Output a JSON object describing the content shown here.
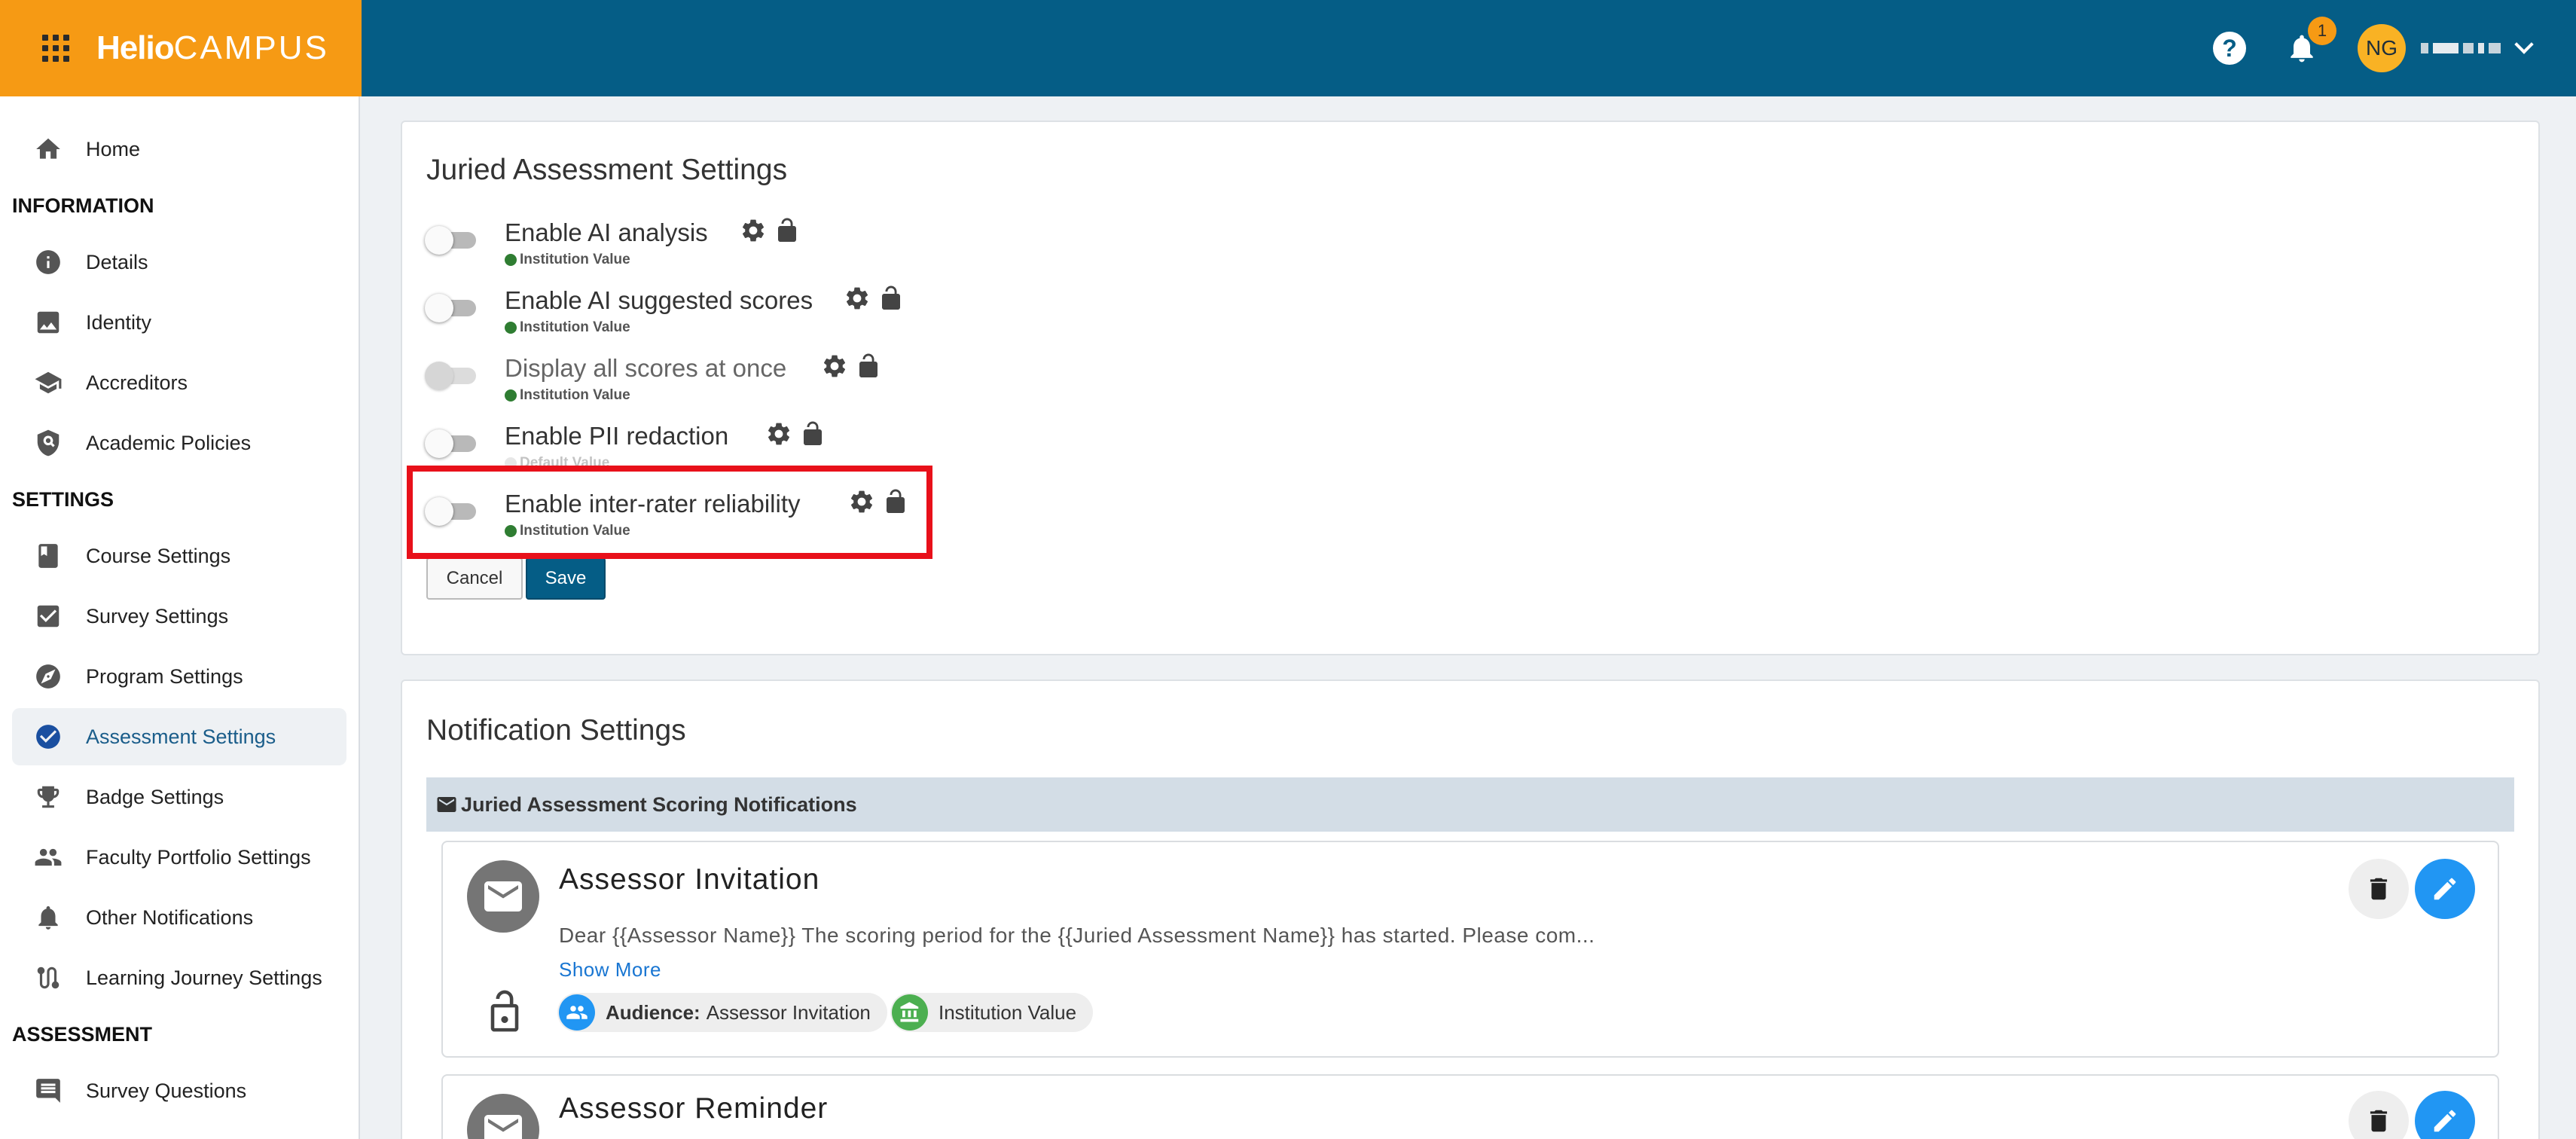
{
  "brand": {
    "logo_bold": "Helio",
    "logo_thin": "CAMPUS"
  },
  "header": {
    "help_glyph": "?",
    "notification_count": "1",
    "user_initials": "NG"
  },
  "sidebar": {
    "items": [
      {
        "label": "Home",
        "icon": "home-icon"
      },
      {
        "label": "Details",
        "icon": "info-icon"
      },
      {
        "label": "Identity",
        "icon": "image-icon"
      },
      {
        "label": "Accreditors",
        "icon": "school-icon"
      },
      {
        "label": "Academic Policies",
        "icon": "policy-icon"
      },
      {
        "label": "Course Settings",
        "icon": "book-icon"
      },
      {
        "label": "Survey Settings",
        "icon": "checkbox-icon"
      },
      {
        "label": "Program Settings",
        "icon": "compass-icon"
      },
      {
        "label": "Assessment Settings",
        "icon": "check-circle-icon"
      },
      {
        "label": "Badge Settings",
        "icon": "trophy-icon"
      },
      {
        "label": "Faculty Portfolio Settings",
        "icon": "people-icon"
      },
      {
        "label": "Other Notifications",
        "icon": "bell-icon"
      },
      {
        "label": "Learning Journey Settings",
        "icon": "route-icon"
      },
      {
        "label": "Survey Questions",
        "icon": "comment-icon"
      }
    ],
    "sections": [
      "INFORMATION",
      "SETTINGS",
      "ASSESSMENT"
    ]
  },
  "juried": {
    "title": "Juried Assessment Settings",
    "settings": [
      {
        "label": "Enable AI analysis",
        "sub": "Institution Value",
        "enabled": false
      },
      {
        "label": "Enable AI suggested scores",
        "sub": "Institution Value",
        "enabled": false
      },
      {
        "label": "Display all scores at once",
        "sub": "Institution Value",
        "enabled": false,
        "disabled": true
      },
      {
        "label": "Enable PII redaction",
        "sub": "Default Value",
        "enabled": false
      },
      {
        "label": "Enable inter-rater reliability",
        "sub": "Institution Value",
        "enabled": false
      }
    ],
    "cancel_label": "Cancel",
    "save_label": "Save"
  },
  "notifications": {
    "title": "Notification Settings",
    "group_label": "Juried Assessment Scoring Notifications",
    "items": [
      {
        "title": "Assessor Invitation",
        "body": "Dear {{Assessor Name}} The scoring period for the {{Juried Assessment Name}} has started. Please com...",
        "show_more": "Show More",
        "audience_label": "Audience:",
        "audience_value": "Assessor Invitation",
        "value_chip": "Institution Value"
      },
      {
        "title": "Assessor Reminder"
      }
    ]
  },
  "colors": {
    "header": "#055d86",
    "brand": "#f69a14",
    "highlight": "#e8101a",
    "primary": "#055d86",
    "edit": "#2196f3"
  }
}
